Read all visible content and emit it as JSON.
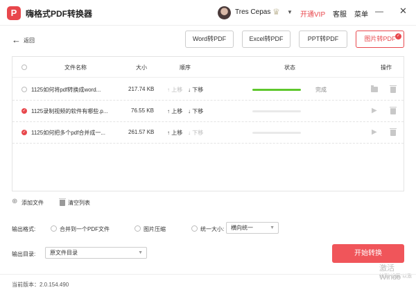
{
  "app": {
    "logo_letter": "P",
    "title": "嗨格式PDF转换器"
  },
  "user": {
    "name": "Tres Cepas",
    "vip_label": "开通VIP",
    "service_label": "客服",
    "menu_label": "菜单"
  },
  "window": {
    "minimize": "—",
    "close": "✕"
  },
  "toolbar": {
    "back_label": "返回",
    "buttons": [
      "Word转PDF",
      "Excel转PDF",
      "PPT转PDF",
      "图片转PDF"
    ],
    "active_index": 3
  },
  "table": {
    "headers": {
      "name": "文件名称",
      "size": "大小",
      "order": "顺序",
      "status": "状态",
      "action": "操作"
    },
    "move_up": "↑ 上移",
    "move_down": "↓ 下移",
    "rows": [
      {
        "name": "1125如何将pdf转换成word...",
        "size": "217.74 KB",
        "progress": 1.0,
        "status": "完成",
        "checked": false
      },
      {
        "name": "1125录制视频的软件有哪些.p...",
        "size": "76.55 KB",
        "progress": 0.0,
        "status": "",
        "checked": true
      },
      {
        "name": "1125如何把多个pdf合并成一...",
        "size": "261.57 KB",
        "progress": 0.0,
        "status": "",
        "checked": true
      }
    ]
  },
  "file_actions": {
    "add_file": "添加文件",
    "clear_list": "清空列表"
  },
  "output_format": {
    "label": "输出格式:",
    "options": [
      "合并到一个PDF文件",
      "图片压缩",
      "统一大小:"
    ],
    "size_select_value": "横向统一"
  },
  "output_dir": {
    "label": "输出目录:",
    "value": "原文件目录"
  },
  "start_button": "开始转换",
  "watermark": {
    "line1": "激活 Windo",
    "line2": "转到\"设置\"以激"
  },
  "footer": {
    "version": "当前版本：2.0.154.490"
  },
  "colors": {
    "accent": "#e8474c",
    "progress_done": "#5ec72d"
  }
}
